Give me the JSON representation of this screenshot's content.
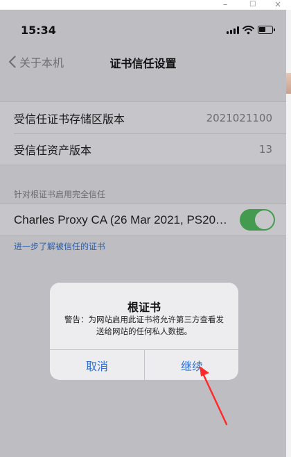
{
  "window": {
    "controls": {
      "minimize": "–",
      "maximize": "□",
      "close": "×"
    }
  },
  "status_bar": {
    "time": "15:34",
    "icons": [
      "signal-icon",
      "wifi-icon",
      "battery-icon"
    ]
  },
  "navbar": {
    "back_label": "关于本机",
    "title": "证书信任设置"
  },
  "info_rows": [
    {
      "label": "受信任证书存储区版本",
      "value": "2021021100"
    },
    {
      "label": "受信任资产版本",
      "value": "13"
    }
  ],
  "trust_section": {
    "header": "针对根证书启用完全信任",
    "certificate_label": "Charles Proxy CA (26 Mar 2021, PS202...",
    "enabled": true,
    "learn_more": "进一步了解被信任的证书"
  },
  "alert": {
    "title": "根证书",
    "message": "警告：为网站启用此证书将允许第三方查看发送给网站的任何私人数据。",
    "cancel_label": "取消",
    "continue_label": "继续"
  },
  "colors": {
    "accent": "#2c6ed6",
    "toggle_on": "#449a4e",
    "arrow": "#ff2a2a"
  }
}
